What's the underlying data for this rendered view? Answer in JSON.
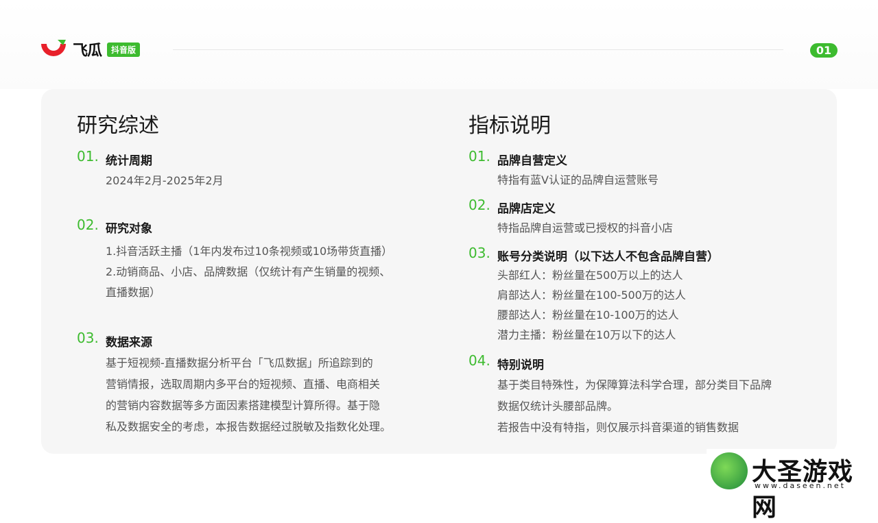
{
  "header": {
    "brand_name": "飞瓜",
    "brand_badge": "抖音版",
    "page_number": "01",
    "brand_color": "#3dbb2f"
  },
  "left": {
    "title": "研究综述",
    "sections": [
      {
        "num": "01.",
        "heading": "统计周期",
        "lines": [
          "2024年2月-2025年2月"
        ]
      },
      {
        "num": "02.",
        "heading": "研究对象",
        "lines": [
          "1.抖音活跃主播（1年内发布过10条视频或10场带货直播）",
          "2.动销商品、小店、品牌数据（仅统计有产生销量的视频、",
          "直播数据）"
        ]
      },
      {
        "num": "03.",
        "heading": "数据来源",
        "lines": [
          "基于短视频-直播数据分析平台「飞瓜数据」所追踪到的",
          "营销情报，选取周期内多平台的短视频、直播、电商相关",
          "的营销内容数据等多方面因素搭建模型计算所得。基于隐",
          "私及数据安全的考虑，本报告数据经过脱敏及指数化处理。"
        ]
      }
    ]
  },
  "right": {
    "title": "指标说明",
    "sections": [
      {
        "num": "01.",
        "heading": "品牌自营定义",
        "lines": [
          "特指有蓝V认证的品牌自运营账号"
        ]
      },
      {
        "num": "02.",
        "heading": "品牌店定义",
        "lines": [
          "特指品牌自运营或已授权的抖音小店"
        ]
      },
      {
        "num": "03.",
        "heading": "账号分类说明（以下达人不包含品牌自营）",
        "lines": [
          "头部红人：粉丝量在500万以上的达人",
          "肩部达人：粉丝量在100-500万的达人",
          "腰部达人：粉丝量在10-100万的达人",
          "潜力主播：粉丝量在10万以下的达人"
        ]
      },
      {
        "num": "04.",
        "heading": "特别说明",
        "lines": [
          "基于类目特殊性，为保障算法科学合理，部分类目下品牌",
          "数据仅统计头腰部品牌。",
          "若报告中没有特指，则仅展示抖音渠道的销售数据"
        ]
      }
    ]
  },
  "watermark": {
    "title": "大圣游戏网",
    "url": "www.daseen.net"
  }
}
